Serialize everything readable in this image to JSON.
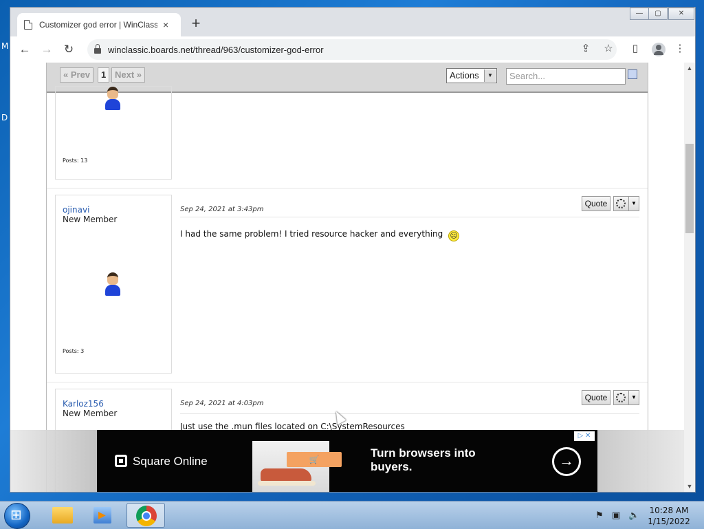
{
  "desktop": {
    "edge_labels": [
      "M",
      "D"
    ]
  },
  "browser": {
    "tab": {
      "title": "Customizer god error | WinClassic",
      "close_icon": "×"
    },
    "new_tab_icon": "+",
    "window_controls": [
      "—",
      "▢",
      "✕"
    ],
    "toolbar": {
      "back": "←",
      "forward": "→",
      "reload": "↻",
      "url": "winclassic.boards.net/thread/963/customizer-god-error",
      "share": "⇪",
      "star": "☆",
      "sidepanel": "▯",
      "menu": "⋮"
    }
  },
  "forum": {
    "pager": {
      "prev": "« Prev",
      "page": "1",
      "next": "Next »"
    },
    "actions": {
      "label": "Actions",
      "arrow": "▼"
    },
    "search": {
      "placeholder": "Search..."
    },
    "posts": [
      {
        "author": "",
        "role": "",
        "posts_label": "Posts: 13",
        "date": "",
        "body": ""
      },
      {
        "author": "ojinavi",
        "role": "New Member",
        "posts_label": "Posts: 3",
        "date": "Sep 24, 2021 at 3:43pm",
        "body": "I had the same problem! I tried resource hacker and everything",
        "quote": "Quote",
        "emoji": "☹"
      },
      {
        "author": "Karloz156",
        "role": "New Member",
        "date": "Sep 24, 2021 at 4:03pm",
        "body": "Just use the .mun files located on C:\\SystemResources",
        "quote": "Quote"
      }
    ]
  },
  "ad": {
    "brand": "Square Online",
    "headline": "Turn browsers into buyers.",
    "cart_icon": "🛒",
    "arrow_icon": "→",
    "badge": "▷ ✕"
  },
  "taskbar": {
    "time": "10:28 AM",
    "date": "1/15/2022"
  }
}
